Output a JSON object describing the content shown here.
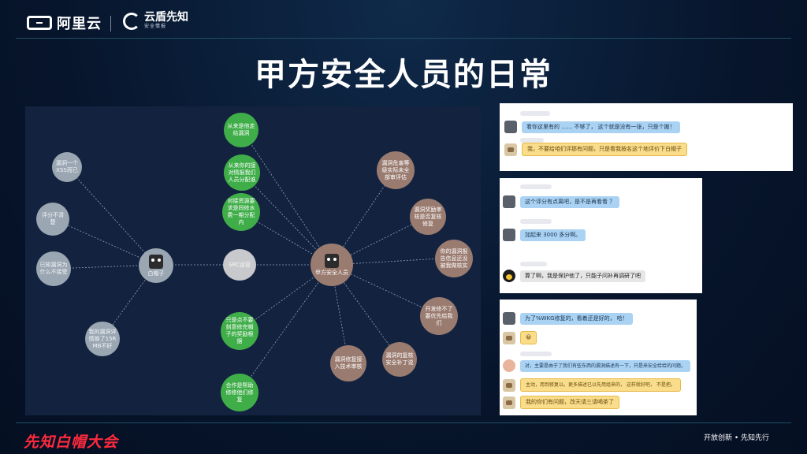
{
  "header": {
    "brand_left": "阿里云",
    "brand_right": "云盾先知",
    "brand_right_sub": "安全情报"
  },
  "slide": {
    "title": "甲方安全人员的日常"
  },
  "graph": {
    "center": {
      "id": "center",
      "label": "甲方安全人员"
    },
    "hub": {
      "id": "hub",
      "label": "白帽子"
    },
    "nodes": [
      {
        "id": "g1",
        "label": "从来是他走给漏洞",
        "color": "green"
      },
      {
        "id": "g2",
        "label": "从来你的接对情报我们人员分配谁",
        "color": "green"
      },
      {
        "id": "g3",
        "label": "对接资源要求是同修水费一期分配内",
        "color": "green"
      },
      {
        "id": "b1",
        "label": "漏洞危害等级实际未全部审评估",
        "color": "brown"
      },
      {
        "id": "b2",
        "label": "漏洞奖励审核是否复核修复",
        "color": "brown"
      },
      {
        "id": "b3",
        "label": "你的漏洞报告信息还没被我做核实",
        "color": "brown"
      },
      {
        "id": "b4",
        "label": "开发修不了要优先给我们",
        "color": "brown"
      },
      {
        "id": "b5",
        "label": "漏洞的复核安全补丁说",
        "color": "brown"
      },
      {
        "id": "b6",
        "label": "漏洞修复接入技术审核",
        "color": "brown"
      },
      {
        "id": "g4",
        "label": "只是点不要刻意修完帽子的奖励根据",
        "color": "green"
      },
      {
        "id": "g5",
        "label": "合作是帮助修修他们修复",
        "color": "green"
      },
      {
        "id": "gr1",
        "label": "漏洞一个XSS而已",
        "color": "gray"
      },
      {
        "id": "gr2",
        "label": "评分不清楚",
        "color": "gray"
      },
      {
        "id": "gr3",
        "label": "已知漏洞为什么不接受",
        "color": "gray"
      },
      {
        "id": "gr4",
        "label": "我的漏洞详情换了15RMB不好",
        "color": "gray"
      },
      {
        "id": "mid",
        "label": "SRC运营",
        "color": "light"
      }
    ]
  },
  "chat1": {
    "messages": [
      {
        "text": "看你这里有的  ……  不够了， 这个就是没有一张，只是个搬！",
        "style": "blue"
      },
      {
        "text": "我，不要给咱们评那有问题，只是看我按名这个地评价下白帽子",
        "style": "yellow"
      }
    ]
  },
  "chat2": {
    "messages": [
      {
        "text": "这个评分有点离吧，是不是再看看 ？",
        "style": "blue"
      },
      {
        "text": "加起来 3000 多分啊。",
        "style": "blue"
      },
      {
        "text": "算了啊，我是保护他了，只能子问补再调研了吧",
        "style": "gray"
      }
    ]
  },
  "chat3": {
    "messages": [
      {
        "text": "为了%WKG修复的，看着还是好的， 哈！",
        "style": "blue"
      },
      {
        "text": "😀",
        "style": "yellow"
      },
      {
        "text": "对，主要是由于了我们有些东西的漏洞描述有一下，只是来安全给给的问题。",
        "style": "blue"
      },
      {
        "text": "主动，用到修复以。更多描述已以先用组来的， 这样就好吧， 不是把。",
        "style": "yellow"
      },
      {
        "text": "我的你们有问题，改天请三请喝茶了",
        "style": "yellow"
      }
    ]
  },
  "footer": {
    "event": "先知白帽大会",
    "slogan": "开放创新 • 先知先行"
  },
  "colors": {
    "background": "#07152c",
    "graph_bg": "#13233f",
    "green": "#3fae49",
    "brown": "#9a7b70",
    "gray": "#9aa6b2",
    "accent_red": "#ff2a3d"
  }
}
